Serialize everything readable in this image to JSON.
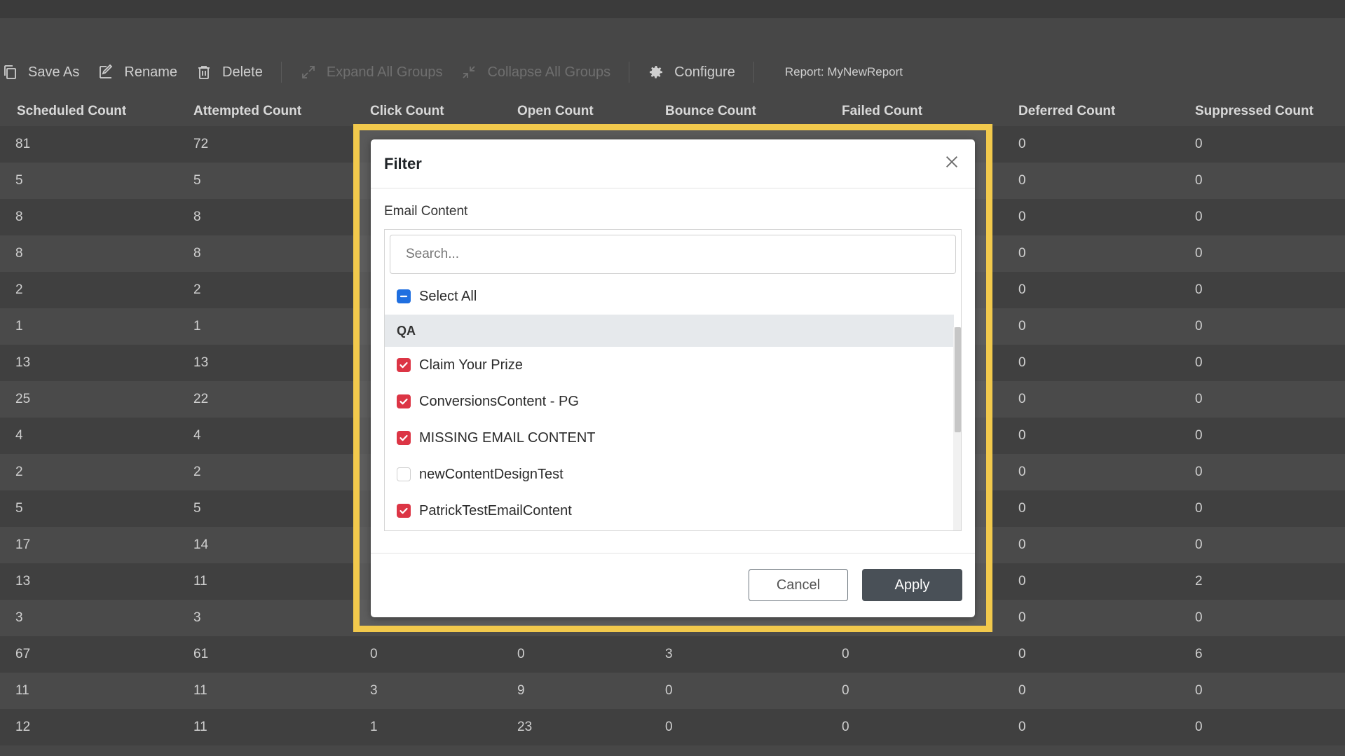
{
  "toolbar": {
    "save_as": "Save As",
    "rename": "Rename",
    "delete": "Delete",
    "expand_all": "Expand All Groups",
    "collapse_all": "Collapse All Groups",
    "configure": "Configure",
    "report_label": "Report: MyNewReport"
  },
  "table": {
    "columns": [
      "Scheduled Count",
      "Attempted Count",
      "Click Count",
      "Open Count",
      "Bounce Count",
      "Failed Count",
      "Deferred Count",
      "Suppressed Count"
    ],
    "rows": [
      [
        "81",
        "72",
        "",
        "",
        "",
        "",
        "0",
        "0"
      ],
      [
        "5",
        "5",
        "",
        "",
        "",
        "",
        "0",
        "0"
      ],
      [
        "8",
        "8",
        "",
        "",
        "",
        "",
        "0",
        "0"
      ],
      [
        "8",
        "8",
        "",
        "",
        "",
        "",
        "0",
        "0"
      ],
      [
        "2",
        "2",
        "",
        "",
        "",
        "",
        "0",
        "0"
      ],
      [
        "1",
        "1",
        "",
        "",
        "",
        "",
        "0",
        "0"
      ],
      [
        "13",
        "13",
        "",
        "",
        "",
        "",
        "0",
        "0"
      ],
      [
        "25",
        "22",
        "",
        "",
        "",
        "",
        "0",
        "0"
      ],
      [
        "4",
        "4",
        "",
        "",
        "",
        "",
        "0",
        "0"
      ],
      [
        "2",
        "2",
        "",
        "",
        "",
        "",
        "0",
        "0"
      ],
      [
        "5",
        "5",
        "",
        "",
        "",
        "",
        "0",
        "0"
      ],
      [
        "17",
        "14",
        "",
        "",
        "",
        "",
        "0",
        "0"
      ],
      [
        "13",
        "11",
        "",
        "",
        "",
        "",
        "0",
        "2"
      ],
      [
        "3",
        "3",
        "",
        "",
        "",
        "",
        "0",
        "0"
      ],
      [
        "67",
        "61",
        "0",
        "0",
        "3",
        "0",
        "0",
        "6"
      ],
      [
        "11",
        "11",
        "3",
        "9",
        "0",
        "0",
        "0",
        "0"
      ],
      [
        "12",
        "11",
        "1",
        "23",
        "0",
        "0",
        "0",
        "0"
      ]
    ]
  },
  "modal": {
    "title": "Filter",
    "field_label": "Email Content",
    "search_placeholder": "Search...",
    "select_all": "Select All",
    "group": "QA",
    "items": [
      {
        "label": "Claim Your Prize",
        "checked": true
      },
      {
        "label": "ConversionsContent - PG",
        "checked": true
      },
      {
        "label": "MISSING EMAIL CONTENT",
        "checked": true
      },
      {
        "label": "newContentDesignTest",
        "checked": false
      },
      {
        "label": "PatrickTestEmailContent",
        "checked": true
      }
    ],
    "cancel": "Cancel",
    "apply": "Apply"
  },
  "colors": {
    "highlight": "#f2c94c",
    "checkbox_checked": "#dc3545",
    "checkbox_indeterminate": "#1f6fe0",
    "apply_button": "#495057"
  },
  "icons": [
    "copy-icon",
    "edit-icon",
    "trash-icon",
    "expand-icon",
    "collapse-icon",
    "gear-icon",
    "close-icon",
    "check-icon",
    "minus-icon"
  ]
}
